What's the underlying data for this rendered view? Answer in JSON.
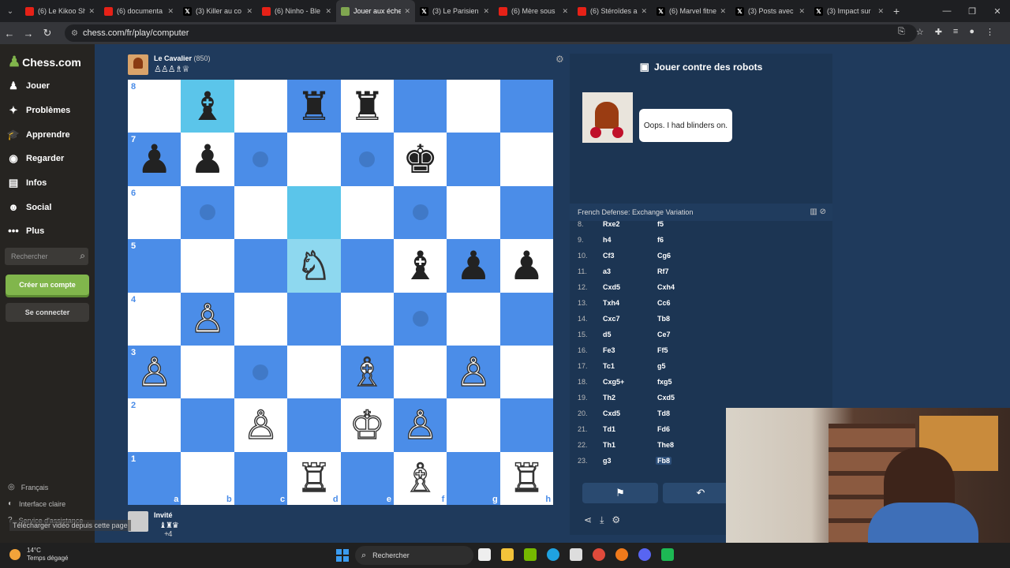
{
  "browser": {
    "tabs": [
      {
        "title": "(6) Le Kikoo Sh",
        "type": "yt"
      },
      {
        "title": "(6) documenta",
        "type": "yt"
      },
      {
        "title": "(3) Killer au co",
        "type": "x"
      },
      {
        "title": "(6) Ninho - Ble",
        "type": "yt"
      },
      {
        "title": "Jouer aux éche",
        "type": "chess",
        "active": true
      },
      {
        "title": "(3) Le Parisien",
        "type": "x"
      },
      {
        "title": "(6) Mère sous",
        "type": "yt"
      },
      {
        "title": "(6) Stéroïdes ai",
        "type": "yt"
      },
      {
        "title": "(6) Marvel fitne",
        "type": "x"
      },
      {
        "title": "(3) Posts avec",
        "type": "x"
      },
      {
        "title": "(3) Impact sur",
        "type": "x"
      }
    ],
    "url": "chess.com/fr/play/computer"
  },
  "sidebar": {
    "logo": "Chess.com",
    "items": [
      {
        "label": "Jouer",
        "icon": "play-icon",
        "glyph": "♟"
      },
      {
        "label": "Problèmes",
        "icon": "puzzle-icon",
        "glyph": "✦"
      },
      {
        "label": "Apprendre",
        "icon": "learn-icon",
        "glyph": "🎓"
      },
      {
        "label": "Regarder",
        "icon": "watch-icon",
        "glyph": "◉"
      },
      {
        "label": "Infos",
        "icon": "news-icon",
        "glyph": "▤"
      },
      {
        "label": "Social",
        "icon": "social-icon",
        "glyph": "☻"
      },
      {
        "label": "Plus",
        "icon": "more-icon",
        "glyph": "•••"
      }
    ],
    "search_placeholder": "Rechercher",
    "signup": "Créer un compte",
    "login": "Se connecter",
    "footer": [
      {
        "label": "Français",
        "glyph": "◎"
      },
      {
        "label": "Interface claire",
        "glyph": "◐"
      },
      {
        "label": "Service d'assistance",
        "glyph": "?"
      }
    ]
  },
  "top_player": {
    "name": "Le Cavalier",
    "rating": "(850)",
    "captured": "♙♙♙♗♕"
  },
  "bottom_player": {
    "name": "Invité",
    "captured": "♝♜♛",
    "advantage": "+4"
  },
  "board": {
    "ranks": [
      "8",
      "7",
      "6",
      "5",
      "4",
      "3",
      "2",
      "1"
    ],
    "files": [
      "a",
      "b",
      "c",
      "d",
      "e",
      "f",
      "g",
      "h"
    ],
    "rows": [
      [
        "",
        "b:♝",
        "",
        "b:♜",
        "b:♜",
        "",
        "",
        ""
      ],
      [
        "b:♟",
        "b:♟",
        "",
        "",
        "",
        "b:♚",
        "",
        ""
      ],
      [
        "",
        "",
        "",
        "",
        "",
        "",
        "",
        ""
      ],
      [
        "",
        "",
        "",
        "w:♘",
        "",
        "b:♝",
        "b:♟",
        "b:♟"
      ],
      [
        "",
        "w:♙",
        "",
        "",
        "",
        "",
        "",
        ""
      ],
      [
        "w:♙",
        "",
        "",
        "",
        "w:♗",
        "",
        "w:♙",
        ""
      ],
      [
        "",
        "",
        "w:♙",
        "",
        "w:♔",
        "w:♙",
        "",
        ""
      ],
      [
        "",
        "",
        "",
        "w:♖",
        "",
        "w:♗",
        "",
        "w:♖"
      ]
    ],
    "highlights": [
      "b8",
      "d6",
      "d5"
    ],
    "move_dots": [
      "c7",
      "e7",
      "b6",
      "f6",
      "f4",
      "c3"
    ]
  },
  "panel": {
    "title": "Jouer contre des robots",
    "bot_message": "Oops. I had blinders on.",
    "opening": "French Defense: Exchange Variation",
    "moves": [
      {
        "n": "8.",
        "w": "Rxe2",
        "b": "f5"
      },
      {
        "n": "9.",
        "w": "h4",
        "b": "f6"
      },
      {
        "n": "10.",
        "w": "Cf3",
        "b": "Cg6"
      },
      {
        "n": "11.",
        "w": "a3",
        "b": "Rf7"
      },
      {
        "n": "12.",
        "w": "Cxd5",
        "b": "Cxh4"
      },
      {
        "n": "13.",
        "w": "Txh4",
        "b": "Cc6"
      },
      {
        "n": "14.",
        "w": "Cxc7",
        "b": "Tb8"
      },
      {
        "n": "15.",
        "w": "d5",
        "b": "Ce7"
      },
      {
        "n": "16.",
        "w": "Fe3",
        "b": "Ff5"
      },
      {
        "n": "17.",
        "w": "Tc1",
        "b": "g5"
      },
      {
        "n": "18.",
        "w": "Cxg5+",
        "b": "fxg5"
      },
      {
        "n": "19.",
        "w": "Th2",
        "b": "Cxd5"
      },
      {
        "n": "20.",
        "w": "Cxd5",
        "b": "Td8"
      },
      {
        "n": "21.",
        "w": "Td1",
        "b": "Fd6"
      },
      {
        "n": "22.",
        "w": "Th1",
        "b": "The8"
      },
      {
        "n": "23.",
        "w": "g3",
        "b": "Fb8",
        "current": true
      }
    ]
  },
  "footer": {
    "download_text": "Télécharger vidéo depuis cette page",
    "weather_temp": "14°C",
    "weather_desc": "Temps dégagé",
    "taskbar_search": "Rechercher"
  }
}
